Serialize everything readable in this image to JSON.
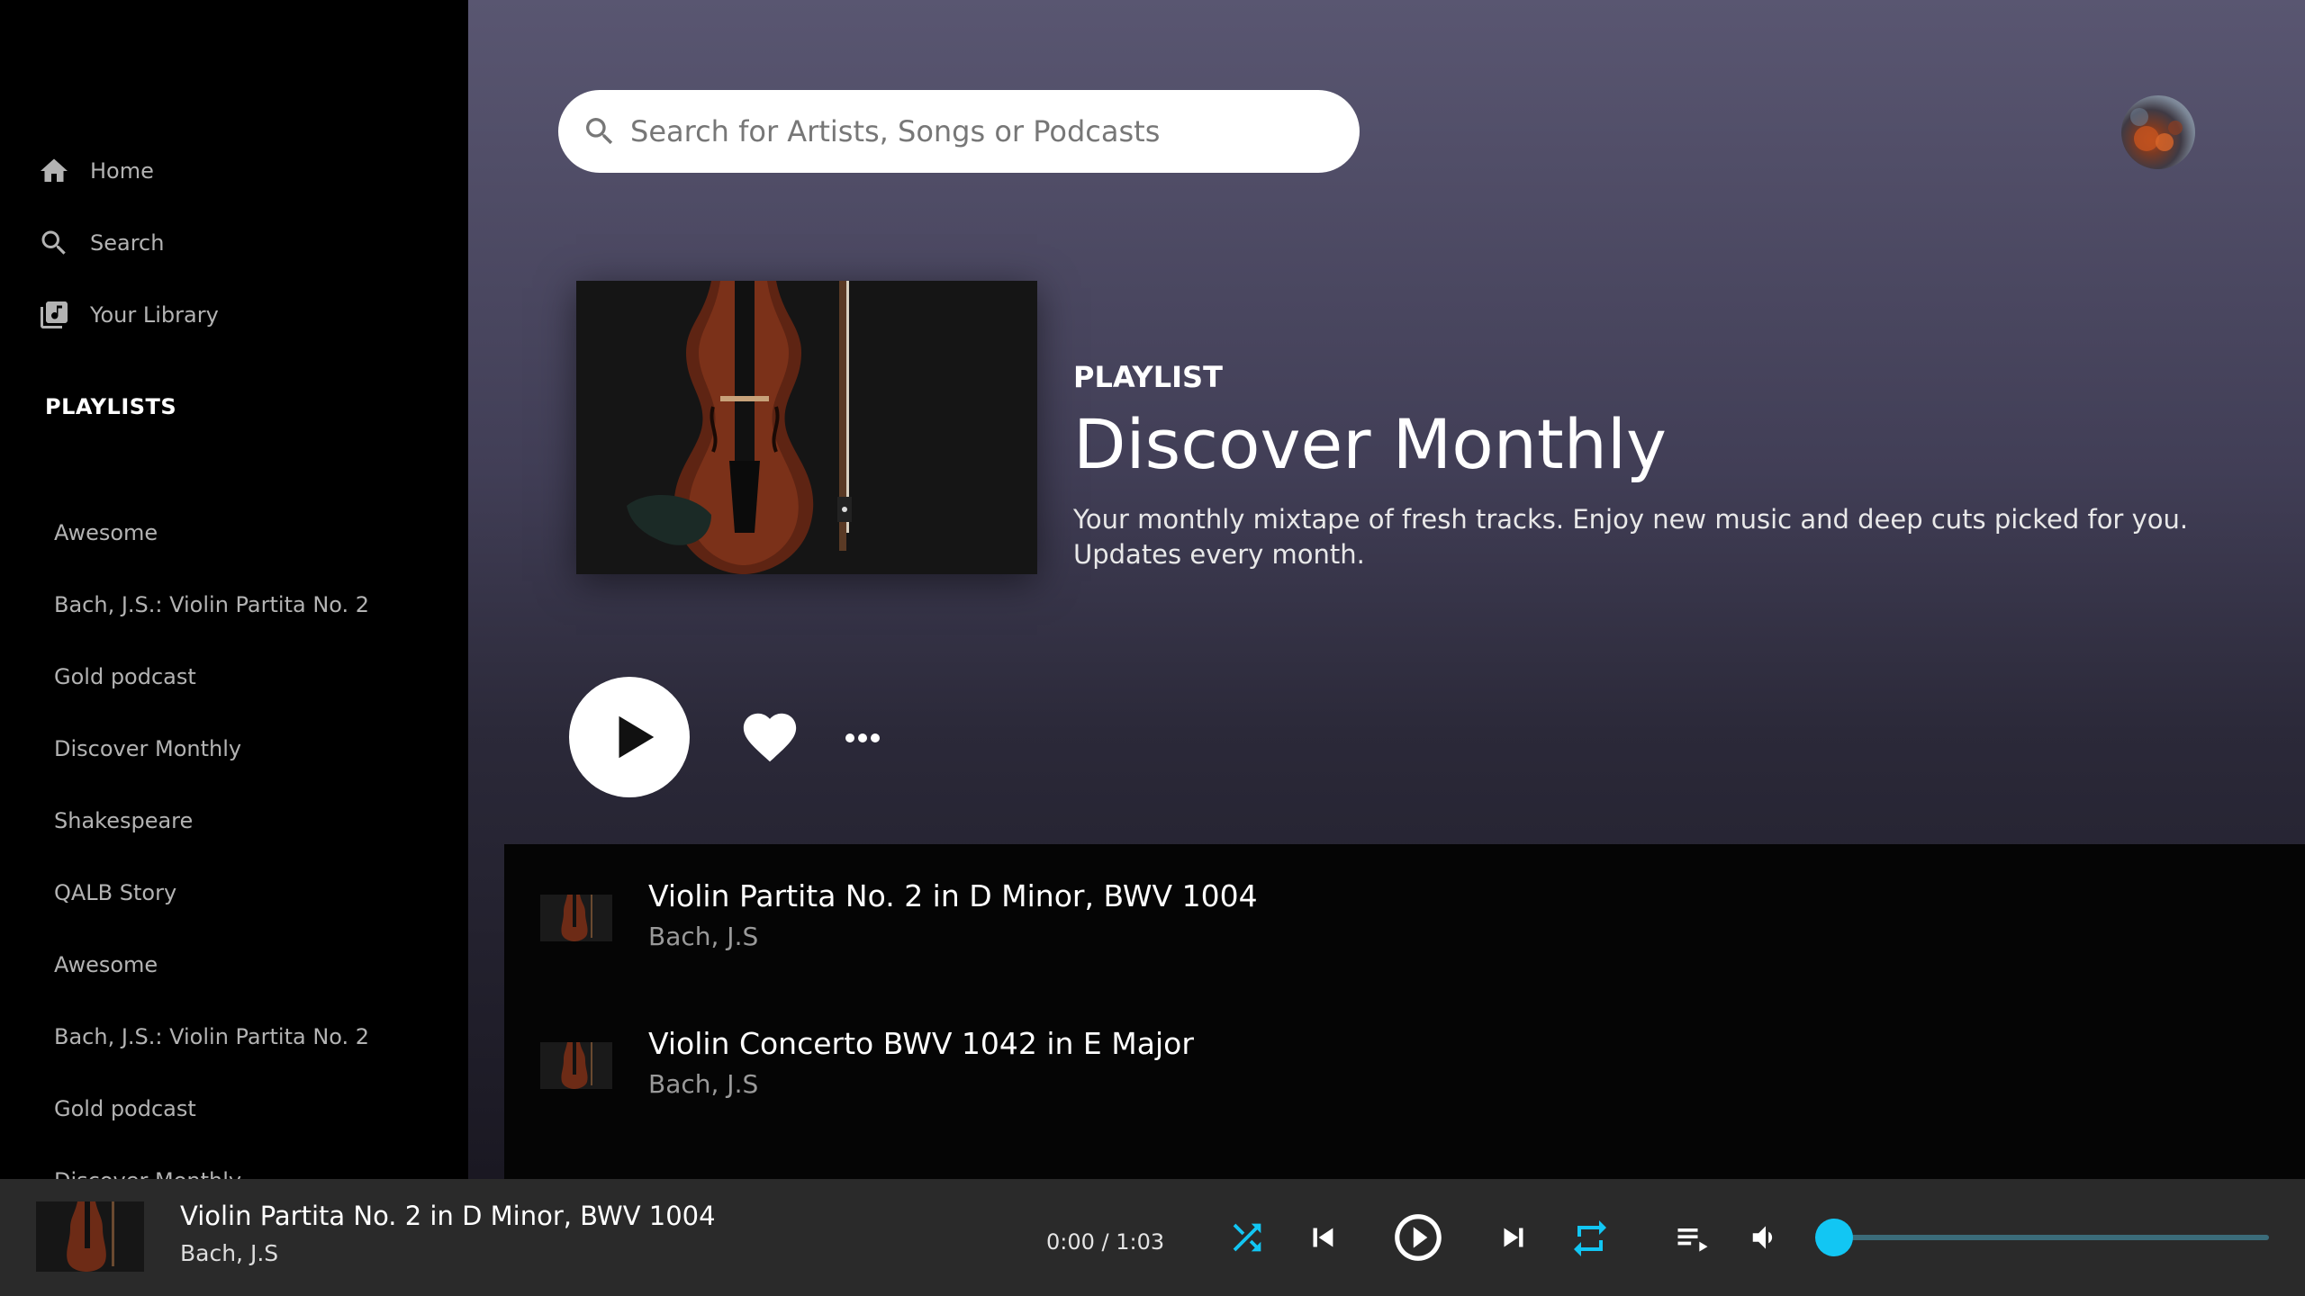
{
  "sidebar": {
    "nav": [
      {
        "label": "Home",
        "icon": "home-icon"
      },
      {
        "label": "Search",
        "icon": "search-icon"
      },
      {
        "label": "Your Library",
        "icon": "library-icon"
      }
    ],
    "playlists_heading": "PLAYLISTS",
    "playlists": [
      "Awesome",
      "Bach, J.S.: Violin Partita No. 2",
      "Gold podcast",
      "Discover Monthly",
      "Shakespeare",
      "QALB Story",
      "Awesome",
      "Bach, J.S.: Violin Partita No. 2",
      "Gold podcast",
      "Discover Monthly"
    ]
  },
  "search": {
    "placeholder": "Search for Artists, Songs or Podcasts",
    "icon": "search-icon"
  },
  "header": {
    "avatar_icon": "user-avatar"
  },
  "playlist": {
    "type_label": "PLAYLIST",
    "title": "Discover Monthly",
    "description": "Your monthly mixtape of fresh tracks. Enjoy new music and deep cuts picked for you. Updates every month.",
    "cover_icon": "violin-image"
  },
  "actions": {
    "play_icon": "play-icon",
    "like_icon": "heart-icon",
    "more_icon": "more-icon"
  },
  "tracks": [
    {
      "title": "Violin Partita No. 2 in D Minor, BWV 1004",
      "artist": "Bach, J.S"
    },
    {
      "title": "Violin Concerto BWV 1042 in E Major",
      "artist": "Bach, J.S"
    }
  ],
  "player": {
    "title": "Violin Partita No. 2 in D Minor, BWV 1004",
    "artist": "Bach, J.S",
    "time": "0:00 / 1:03",
    "controls": [
      "shuffle-icon",
      "previous-icon",
      "play-icon",
      "next-icon",
      "repeat-icon",
      "queue-icon",
      "volume-icon"
    ],
    "volume_level": 0,
    "accent_color": "#12c6f3"
  }
}
